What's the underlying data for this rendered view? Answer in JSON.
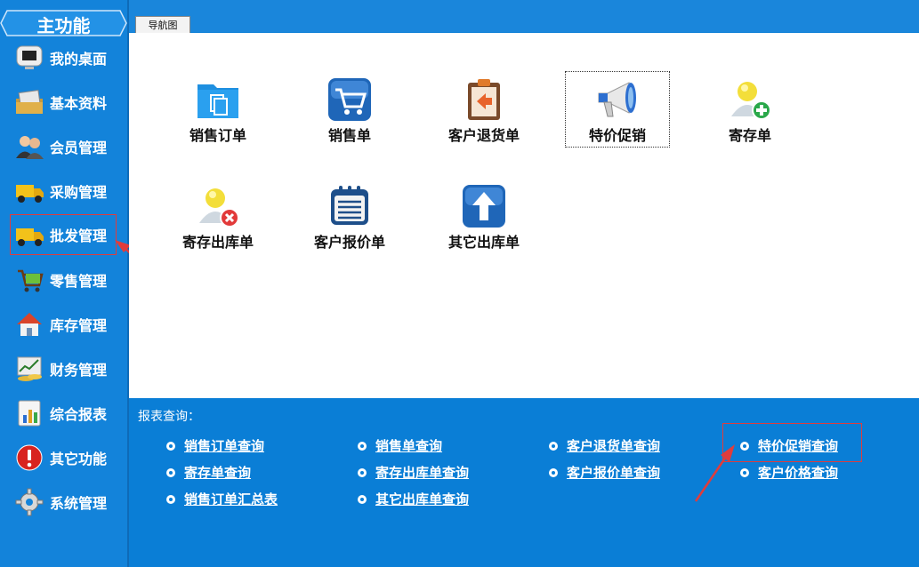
{
  "sidebar": {
    "title": "主功能",
    "items": [
      {
        "label": "我的桌面",
        "icon": "desktop-icon"
      },
      {
        "label": "基本资料",
        "icon": "folder-docs-icon"
      },
      {
        "label": "会员管理",
        "icon": "members-icon"
      },
      {
        "label": "采购管理",
        "icon": "truck-icon"
      },
      {
        "label": "批发管理",
        "icon": "wholesale-truck-icon"
      },
      {
        "label": "零售管理",
        "icon": "cart-icon"
      },
      {
        "label": "库存管理",
        "icon": "house-icon"
      },
      {
        "label": "财务管理",
        "icon": "finance-chart-icon"
      },
      {
        "label": "综合报表",
        "icon": "report-icon"
      },
      {
        "label": "其它功能",
        "icon": "alert-icon"
      },
      {
        "label": "系统管理",
        "icon": "gear-icon"
      }
    ]
  },
  "tabs": {
    "active": "导航图"
  },
  "nav": {
    "items": [
      {
        "label": "销售订单",
        "icon": "sales-order-icon"
      },
      {
        "label": "销售单",
        "icon": "shopping-cart-icon"
      },
      {
        "label": "客户退货单",
        "icon": "return-clipboard-icon"
      },
      {
        "label": "特价促销",
        "icon": "megaphone-icon"
      },
      {
        "label": "寄存单",
        "icon": "user-add-icon"
      },
      {
        "label": "寄存出库单",
        "icon": "user-remove-icon"
      },
      {
        "label": "客户报价单",
        "icon": "calendar-list-icon"
      },
      {
        "label": "其它出库单",
        "icon": "upload-arrow-icon"
      }
    ]
  },
  "reports": {
    "title": "报表查询：",
    "links": [
      "销售订单查询",
      "销售单查询",
      "客户退货单查询",
      "特价促销查询",
      "寄存单查询",
      "寄存出库单查询",
      "客户报价单查询",
      "客户价格查询",
      "销售订单汇总表",
      "其它出库单查询"
    ]
  },
  "colors": {
    "background": "#0a7ed6",
    "sidebar": "#1383da",
    "highlight": "#e03c3c"
  }
}
